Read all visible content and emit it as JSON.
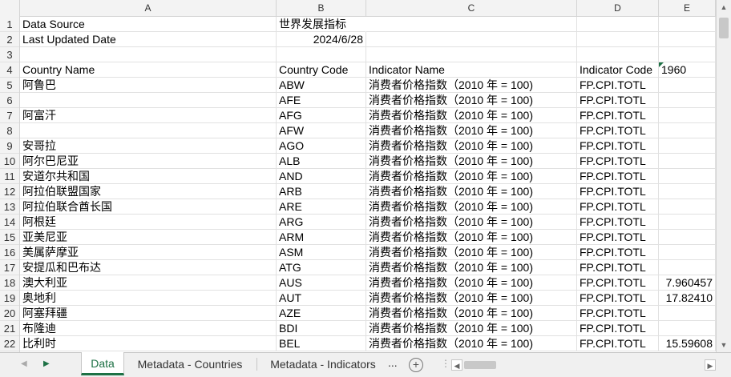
{
  "columns": [
    "A",
    "B",
    "C",
    "D",
    "E"
  ],
  "row_numbers": [
    "1",
    "2",
    "3",
    "4",
    "5",
    "6",
    "7",
    "8",
    "9",
    "10",
    "11",
    "12",
    "13",
    "14",
    "15",
    "16",
    "17",
    "18",
    "19",
    "20",
    "21",
    "22"
  ],
  "meta": {
    "data_source_label": "Data Source",
    "data_source_value": "世界发展指标",
    "last_updated_label": "Last Updated Date",
    "last_updated_value": "2024/6/28"
  },
  "header": {
    "country_name": "Country Name",
    "country_code": "Country Code",
    "indicator_name": "Indicator Name",
    "indicator_code": "Indicator Code",
    "year": "1960"
  },
  "rows": [
    {
      "name": "阿鲁巴",
      "code": "ABW",
      "indicator": "消费者价格指数（2010 年 = 100)",
      "icode": "FP.CPI.TOTL",
      "val": ""
    },
    {
      "name": "",
      "code": "AFE",
      "indicator": "消费者价格指数（2010 年 = 100)",
      "icode": "FP.CPI.TOTL",
      "val": ""
    },
    {
      "name": "阿富汗",
      "code": "AFG",
      "indicator": "消费者价格指数（2010 年 = 100)",
      "icode": "FP.CPI.TOTL",
      "val": ""
    },
    {
      "name": "",
      "code": "AFW",
      "indicator": "消费者价格指数（2010 年 = 100)",
      "icode": "FP.CPI.TOTL",
      "val": ""
    },
    {
      "name": "安哥拉",
      "code": "AGO",
      "indicator": "消费者价格指数（2010 年 = 100)",
      "icode": "FP.CPI.TOTL",
      "val": ""
    },
    {
      "name": "阿尔巴尼亚",
      "code": "ALB",
      "indicator": "消费者价格指数（2010 年 = 100)",
      "icode": "FP.CPI.TOTL",
      "val": ""
    },
    {
      "name": "安道尔共和国",
      "code": "AND",
      "indicator": "消费者价格指数（2010 年 = 100)",
      "icode": "FP.CPI.TOTL",
      "val": ""
    },
    {
      "name": "阿拉伯联盟国家",
      "code": "ARB",
      "indicator": "消费者价格指数（2010 年 = 100)",
      "icode": "FP.CPI.TOTL",
      "val": ""
    },
    {
      "name": "阿拉伯联合酋长国",
      "code": "ARE",
      "indicator": "消费者价格指数（2010 年 = 100)",
      "icode": "FP.CPI.TOTL",
      "val": ""
    },
    {
      "name": "阿根廷",
      "code": "ARG",
      "indicator": "消费者价格指数（2010 年 = 100)",
      "icode": "FP.CPI.TOTL",
      "val": ""
    },
    {
      "name": "亚美尼亚",
      "code": "ARM",
      "indicator": "消费者价格指数（2010 年 = 100)",
      "icode": "FP.CPI.TOTL",
      "val": ""
    },
    {
      "name": "美属萨摩亚",
      "code": "ASM",
      "indicator": "消费者价格指数（2010 年 = 100)",
      "icode": "FP.CPI.TOTL",
      "val": ""
    },
    {
      "name": "安提瓜和巴布达",
      "code": "ATG",
      "indicator": "消费者价格指数（2010 年 = 100)",
      "icode": "FP.CPI.TOTL",
      "val": ""
    },
    {
      "name": "澳大利亚",
      "code": "AUS",
      "indicator": "消费者价格指数（2010 年 = 100)",
      "icode": "FP.CPI.TOTL",
      "val": "7.960457"
    },
    {
      "name": "奥地利",
      "code": "AUT",
      "indicator": "消费者价格指数（2010 年 = 100)",
      "icode": "FP.CPI.TOTL",
      "val": "17.82410"
    },
    {
      "name": "阿塞拜疆",
      "code": "AZE",
      "indicator": "消费者价格指数（2010 年 = 100)",
      "icode": "FP.CPI.TOTL",
      "val": ""
    },
    {
      "name": "布隆迪",
      "code": "BDI",
      "indicator": "消费者价格指数（2010 年 = 100)",
      "icode": "FP.CPI.TOTL",
      "val": ""
    },
    {
      "name": "比利时",
      "code": "BEL",
      "indicator": "消费者价格指数（2010 年 = 100)",
      "icode": "FP.CPI.TOTL",
      "val": "15.59608"
    }
  ],
  "tabs": {
    "active": "Data",
    "second": "Metadata - Countries",
    "third": "Metadata - Indicators",
    "more": "...",
    "add": "+"
  },
  "icons": {
    "nav_prev": "◀",
    "nav_next": "▶",
    "scroll_up": "▲",
    "scroll_down": "▼",
    "scroll_left": "◀",
    "scroll_right": "▶",
    "splitter": "⋮"
  },
  "colors": {
    "accent": "#1e7145",
    "grid": "#e1e1e1",
    "header_bg": "#f3f3f3"
  }
}
